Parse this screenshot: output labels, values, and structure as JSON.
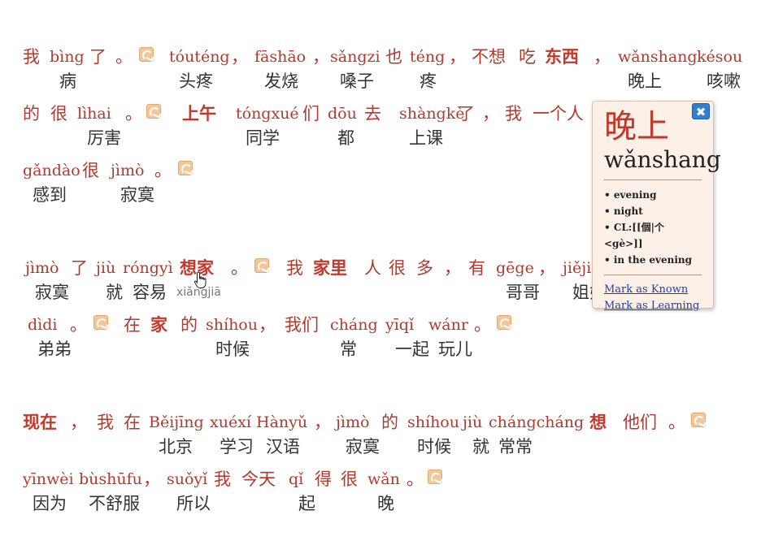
{
  "lines": [
    {
      "tokens": [
        {
          "top": "我",
          "cn": true
        },
        {
          "top": "bìng",
          "bottom": "病"
        },
        {
          "top": "了",
          "cn": true
        },
        {
          "top": "。",
          "cn": true
        },
        {
          "icon": true
        },
        {
          "top": "tóuténg",
          "bottom": "头疼"
        },
        {
          "top": "，",
          "cn": true
        },
        {
          "top": "fāshāo",
          "bottom": "发烧"
        },
        {
          "top": "，",
          "cn": true
        },
        {
          "top": "sǎngzi",
          "bottom": "嗓子"
        },
        {
          "top": "也",
          "cn": true
        },
        {
          "top": "téng",
          "bottom": "疼"
        },
        {
          "top": "，",
          "cn": true
        },
        {
          "top": "不想",
          "cn": true
        },
        {
          "top": "吃",
          "cn": true
        },
        {
          "top": "东西",
          "cn": true,
          "bold": true
        },
        {
          "top": "，",
          "cn": true
        },
        {
          "top": "wǎnshang",
          "bottom": "晚上"
        },
        {
          "top": "késou",
          "bottom": "咳嗽"
        }
      ]
    },
    {
      "tokens": [
        {
          "top": "的",
          "cn": true
        },
        {
          "top": "很",
          "cn": true
        },
        {
          "top": "lìhai",
          "bottom": "厉害"
        },
        {
          "top": "。",
          "cn": true
        },
        {
          "icon": true
        },
        {
          "top": "上午",
          "cn": true,
          "bold": true
        },
        {
          "top": "tóngxué",
          "bottom": "同学"
        },
        {
          "top": "们",
          "cn": true
        },
        {
          "top": "dōu",
          "bottom": "都"
        },
        {
          "top": "去",
          "cn": true
        },
        {
          "top": "shàngkè",
          "bottom": "上课"
        },
        {
          "top": "了",
          "cn": true
        },
        {
          "top": "，",
          "cn": true
        },
        {
          "top": "我",
          "cn": true
        },
        {
          "top": "一个人",
          "cn": true
        }
      ]
    },
    {
      "tokens": [
        {
          "top": "gǎndào",
          "bottom": "感到"
        },
        {
          "top": "很",
          "cn": true
        },
        {
          "top": "jìmò",
          "bottom": "寂寞"
        },
        {
          "top": "。",
          "cn": true
        },
        {
          "icon": true
        }
      ]
    },
    {
      "tokens": [
        {
          "top": "jìmò",
          "bottom": "寂寞"
        },
        {
          "top": "了",
          "cn": true
        },
        {
          "top": "jiù",
          "bottom": "就"
        },
        {
          "top": "róngyì",
          "bottom": "容易"
        },
        {
          "top": "想家",
          "cn": true,
          "bold": true,
          "hint": "xiǎngjiā"
        },
        {
          "top": "。",
          "cn": true
        },
        {
          "icon": true
        },
        {
          "top": "我",
          "cn": true
        },
        {
          "top": "家里",
          "cn": true,
          "bold": true
        },
        {
          "top": "人",
          "cn": true
        },
        {
          "top": "很",
          "cn": true
        },
        {
          "top": "多",
          "cn": true
        },
        {
          "top": "，",
          "cn": true
        },
        {
          "top": "有",
          "cn": true
        },
        {
          "top": "gēge",
          "bottom": "哥哥"
        },
        {
          "top": "，",
          "cn": true
        },
        {
          "top": "jiějie",
          "bottom": "姐姐"
        }
      ]
    },
    {
      "tokens": [
        {
          "top": "dìdi",
          "bottom": "弟弟"
        },
        {
          "top": "。",
          "cn": true
        },
        {
          "icon": true
        },
        {
          "top": "在",
          "cn": true
        },
        {
          "top": "家",
          "cn": true,
          "bold": true
        },
        {
          "top": "的",
          "cn": true
        },
        {
          "top": "shíhou",
          "bottom": "时候"
        },
        {
          "top": "，",
          "cn": true
        },
        {
          "top": "我们",
          "cn": true
        },
        {
          "top": "cháng",
          "bottom": "常"
        },
        {
          "top": "yīqǐ",
          "bottom": "一起"
        },
        {
          "top": "wánr",
          "bottom": "玩儿"
        },
        {
          "top": "。",
          "cn": true
        },
        {
          "icon": true
        }
      ]
    },
    {
      "tokens": [
        {
          "top": "现在",
          "cn": true,
          "bold": true
        },
        {
          "top": "，",
          "cn": true
        },
        {
          "top": "我",
          "cn": true
        },
        {
          "top": "在",
          "cn": true
        },
        {
          "top": "Běijīng",
          "bottom": "北京"
        },
        {
          "top": "xuéxí",
          "bottom": "学习"
        },
        {
          "top": "Hànyǔ",
          "bottom": "汉语"
        },
        {
          "top": "，",
          "cn": true
        },
        {
          "top": "jìmò",
          "bottom": "寂寞"
        },
        {
          "top": "的",
          "cn": true
        },
        {
          "top": "shíhou",
          "bottom": "时候"
        },
        {
          "top": "jiù",
          "bottom": "就"
        },
        {
          "top": "chángcháng",
          "bottom": "常常"
        },
        {
          "top": "想",
          "cn": true,
          "bold": true
        },
        {
          "top": "他们",
          "cn": true
        },
        {
          "top": "。",
          "cn": true
        },
        {
          "icon": true
        }
      ]
    },
    {
      "tokens": [
        {
          "top": "yīnwèi",
          "bottom": "因为"
        },
        {
          "top": "bùshūfu",
          "bottom": "不舒服"
        },
        {
          "top": "，",
          "cn": true
        },
        {
          "top": "suǒyǐ",
          "bottom": "所以"
        },
        {
          "top": "我",
          "cn": true
        },
        {
          "top": "今天",
          "cn": true
        },
        {
          "top": "qǐ",
          "bottom": "起"
        },
        {
          "top": "得",
          "cn": true
        },
        {
          "top": "很",
          "cn": true
        },
        {
          "top": "wǎn",
          "bottom": "晚"
        },
        {
          "top": "。",
          "cn": true
        },
        {
          "icon": true
        }
      ]
    }
  ],
  "popup": {
    "hanzi": "晚上",
    "pinyin": "wǎnshang",
    "close_label": "✖",
    "definitions": [
      "evening",
      "night",
      "CL:[[個|个<gè>]]",
      "in the evening"
    ],
    "mark_known": "Mark as Known",
    "mark_learning": "Mark as Learning"
  },
  "colors": {
    "pinyin": "#b03a2e",
    "hanzi_bottom": "#333333",
    "popup_bg": "#fdf0e6",
    "close_button": "#2f7fd5",
    "link": "#1a3fb5"
  }
}
